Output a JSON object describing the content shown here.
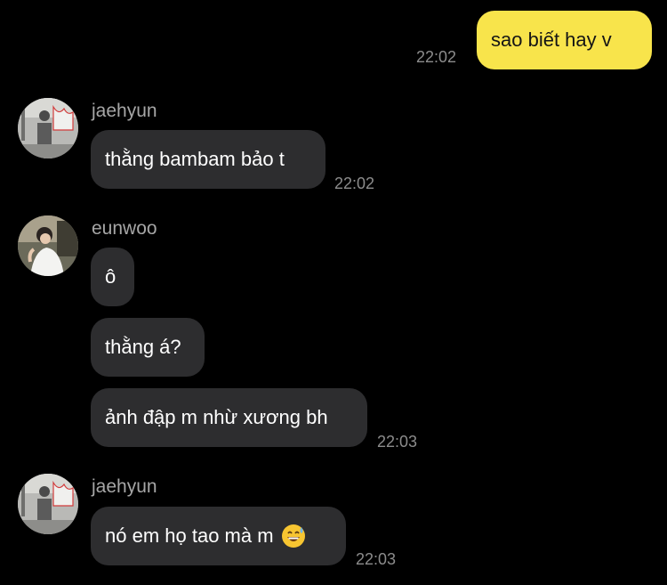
{
  "chat": {
    "messages": [
      {
        "direction": "outgoing",
        "text": "sao biết hay v",
        "time": "22:02"
      },
      {
        "direction": "incoming",
        "sender": "jaehyun",
        "text": "thằng bambam bảo t",
        "time": "22:02"
      },
      {
        "direction": "incoming",
        "sender": "eunwoo",
        "text": "ô"
      },
      {
        "direction": "incoming",
        "text": "thằng á?"
      },
      {
        "direction": "incoming",
        "text": "ảnh đập m nhừ xương bh",
        "time": "22:03"
      },
      {
        "direction": "incoming",
        "sender": "jaehyun",
        "text": "nó em họ tao mà m",
        "emoji": "😅",
        "time": "22:03"
      }
    ]
  },
  "colors": {
    "background": "#000000",
    "outgoing_bubble": "#f8e44b",
    "incoming_bubble": "#2d2d2f",
    "timestamp": "#8c8c8c",
    "sender_name": "#a6a6a6"
  },
  "icons": {
    "avatar_jaehyun": "avatar-photo",
    "avatar_eunwoo": "avatar-photo",
    "emoji": "grinning-face-with-sweat"
  }
}
